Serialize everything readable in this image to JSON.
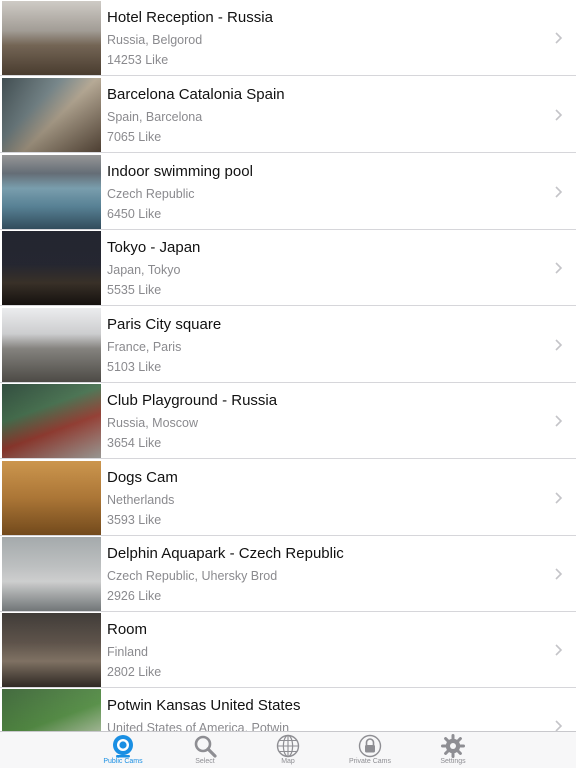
{
  "cams": [
    {
      "title": "Hotel Reception - Russia",
      "location": "Russia, Belgorod",
      "likes": "14253 Like"
    },
    {
      "title": "Barcelona Catalonia Spain",
      "location": "Spain, Barcelona",
      "likes": "7065 Like"
    },
    {
      "title": "Indoor swimming pool",
      "location": "Czech Republic",
      "likes": "6450 Like"
    },
    {
      "title": "Tokyo - Japan",
      "location": "Japan, Tokyo",
      "likes": "5535 Like"
    },
    {
      "title": "Paris City square",
      "location": "France, Paris",
      "likes": "5103 Like"
    },
    {
      "title": "Club Playground - Russia",
      "location": "Russia, Moscow",
      "likes": "3654 Like"
    },
    {
      "title": "Dogs Cam",
      "location": "Netherlands",
      "likes": "3593 Like"
    },
    {
      "title": "Delphin Aquapark  - Czech Republic",
      "location": "Czech Republic, Uhersky Brod",
      "likes": "2926 Like"
    },
    {
      "title": "Room",
      "location": "Finland",
      "likes": "2802 Like"
    },
    {
      "title": "Potwin Kansas United States",
      "location": "United States of America, Potwin",
      "likes": ""
    }
  ],
  "tabs": [
    {
      "label": "Public Cams",
      "icon": "webcam-icon",
      "active": true
    },
    {
      "label": "Select",
      "icon": "search-icon",
      "active": false
    },
    {
      "label": "Map",
      "icon": "globe-icon",
      "active": false
    },
    {
      "label": "Private Cams",
      "icon": "lock-icon",
      "active": false
    },
    {
      "label": "Settings",
      "icon": "gear-icon",
      "active": false
    }
  ],
  "colors": {
    "accent": "#1a8fe3",
    "inactive": "#8e8e93",
    "secondary_text": "#8a8a8e"
  }
}
